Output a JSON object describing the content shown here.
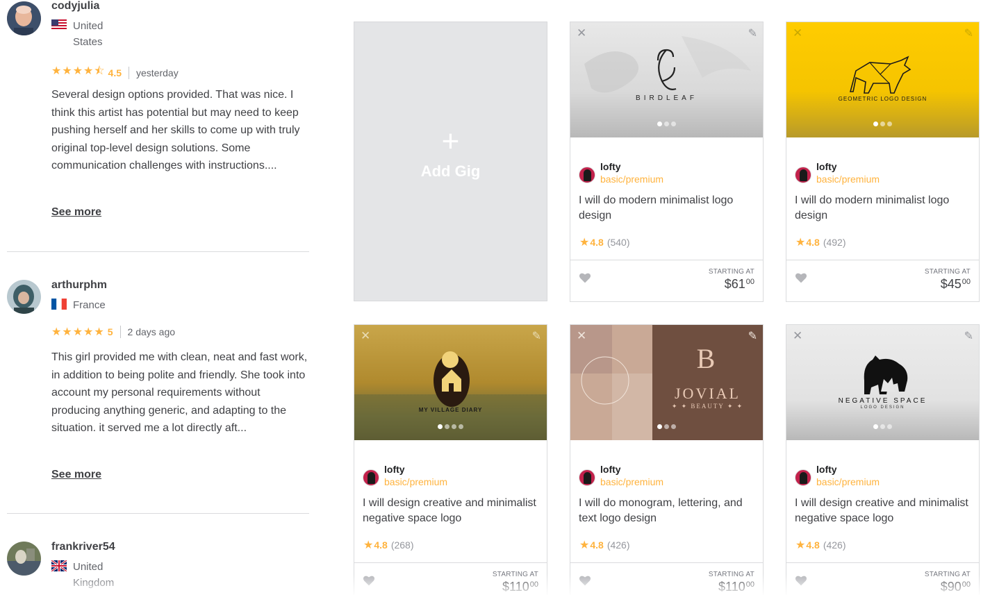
{
  "reviews": [
    {
      "username": "codyjulia",
      "country": "United States",
      "rating": "4.5",
      "stars": "★★★★⯪",
      "time": "yesterday",
      "text": "Several design options provided. That was nice. I think this artist has potential but may need to keep pushing herself and her skills to come up with truly original top-level design solutions. Some communication challenges with instructions....",
      "see_more": "See more"
    },
    {
      "username": "arthurphm",
      "country": "France",
      "rating": "5",
      "stars": "★★★★★",
      "time": "2 days ago",
      "text": "This girl provided me with clean, neat and fast work, in addition to being polite and friendly. She took into account my personal requirements without producing anything generic, and adapting to the situation. it served me a lot directly aft...",
      "see_more": "See more"
    },
    {
      "username": "frankriver54",
      "country": "United Kingdom"
    }
  ],
  "add_gig": {
    "plus": "+",
    "label": "Add Gig"
  },
  "gig_common": {
    "seller": "lofty",
    "level": "basic/premium",
    "starting_at": "STARTING AT"
  },
  "gigs": [
    {
      "thumb_text": "BIRDLEAF",
      "title": "I will do modern minimalist logo design",
      "rating": "4.8",
      "count": "(540)",
      "price": "$61",
      "cents": "00"
    },
    {
      "thumb_text": "GEOMETRIC LOGO DESIGN",
      "title": "I will do modern minimalist logo design",
      "rating": "4.8",
      "count": "(492)",
      "price": "$45",
      "cents": "00"
    },
    {
      "thumb_text": "MY VILLAGE DIARY",
      "title": "I will design creative and minimalist negative space logo",
      "rating": "4.8",
      "count": "(268)",
      "price": "$110",
      "cents": "00"
    },
    {
      "thumb_text": "JOVIAL",
      "thumb_text2": "✦ ✦ BEAUTY ✦ ✦",
      "title": "I will do monogram, lettering, and text logo design",
      "rating": "4.8",
      "count": "(426)",
      "price": "$110",
      "cents": "00"
    },
    {
      "thumb_text": "NEGATIVE SPACE",
      "thumb_text2": "LOGO DESIGN",
      "title": "I will design creative and minimalist negative space logo",
      "rating": "4.8",
      "count": "(426)",
      "price": "$90",
      "cents": "00"
    }
  ],
  "colors": {
    "star": "#ffb33e",
    "text": "#404145",
    "muted": "#62646a"
  }
}
